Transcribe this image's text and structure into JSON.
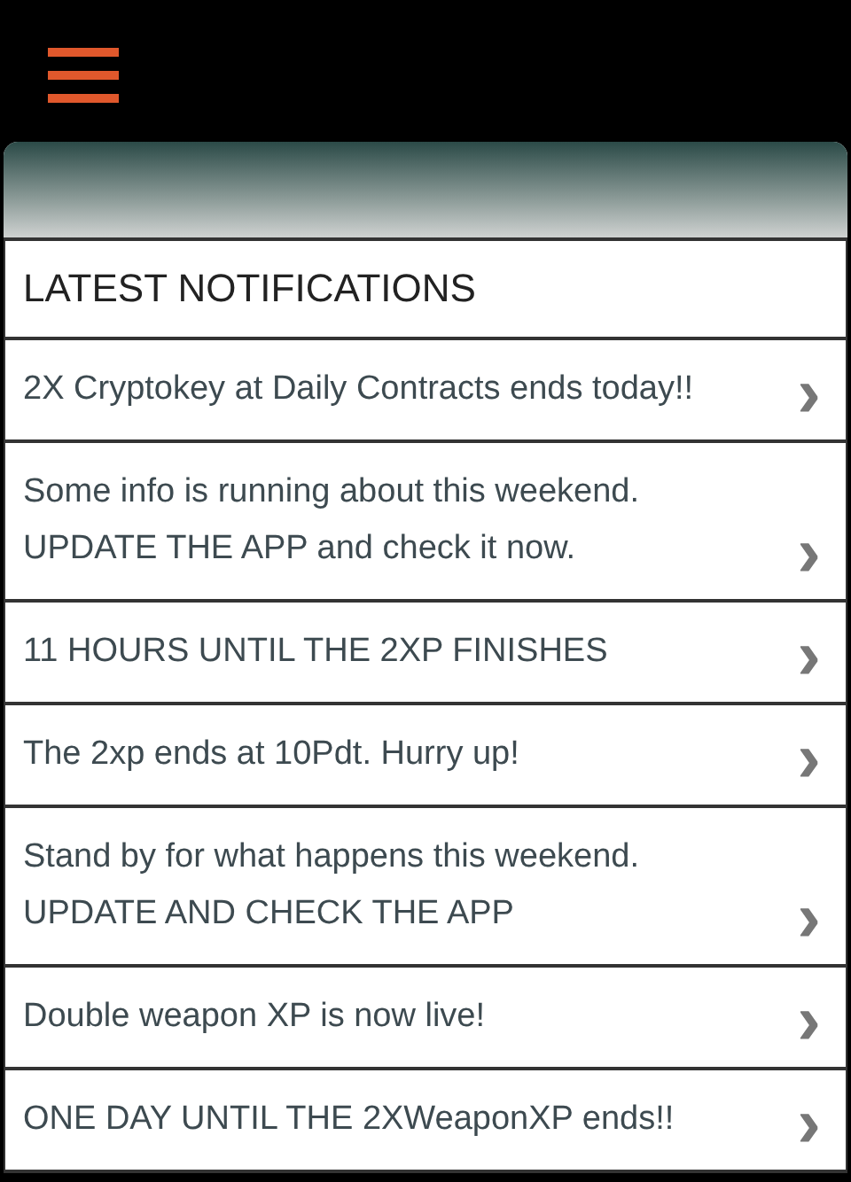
{
  "section": {
    "title": "LATEST NOTIFICATIONS"
  },
  "notifications": [
    {
      "text": "2X Cryptokey at Daily Contracts ends today!!",
      "chevron": "›"
    },
    {
      "text": "Some info is running about this weekend.\nUPDATE THE APP and check it now.",
      "chevron": "›"
    },
    {
      "text": "11 HOURS UNTIL THE 2XP FINISHES",
      "chevron": "›"
    },
    {
      "text": "The 2xp ends at 10Pdt. Hurry up!",
      "chevron": "›"
    },
    {
      "text": "Stand by for what happens this weekend.\nUPDATE AND CHECK THE APP",
      "chevron": "›"
    },
    {
      "text": "Double weapon XP is now live!",
      "chevron": "›"
    },
    {
      "text": "ONE DAY UNTIL THE 2XWeaponXP ends!!",
      "chevron": "›"
    }
  ]
}
